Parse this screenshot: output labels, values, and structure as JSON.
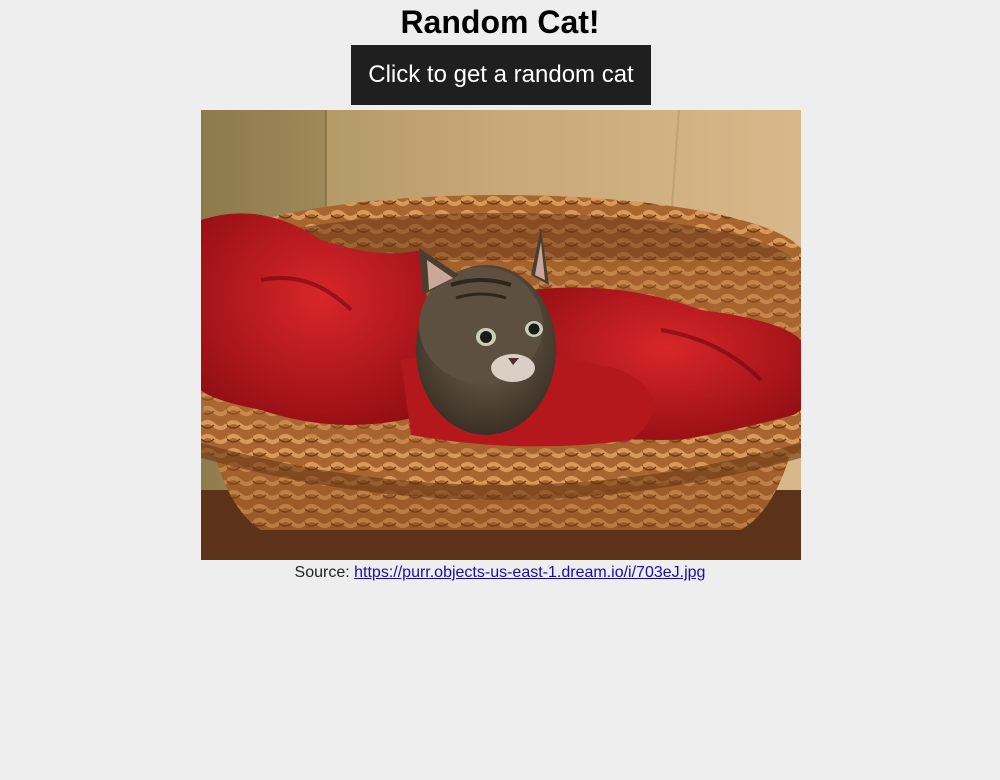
{
  "header": {
    "title": "Random Cat!"
  },
  "controls": {
    "random_button_label": "Click to get a random cat"
  },
  "photo": {
    "subject": "kitten-in-wicker-basket"
  },
  "source": {
    "prefix": "Source: ",
    "url": "https://purr.objects-us-east-1.dream.io/i/703eJ.jpg"
  },
  "colors": {
    "background": "#eeeeee",
    "button_bg": "#1f1f1f",
    "button_text": "#ffffff",
    "link": "#1a0dab"
  }
}
